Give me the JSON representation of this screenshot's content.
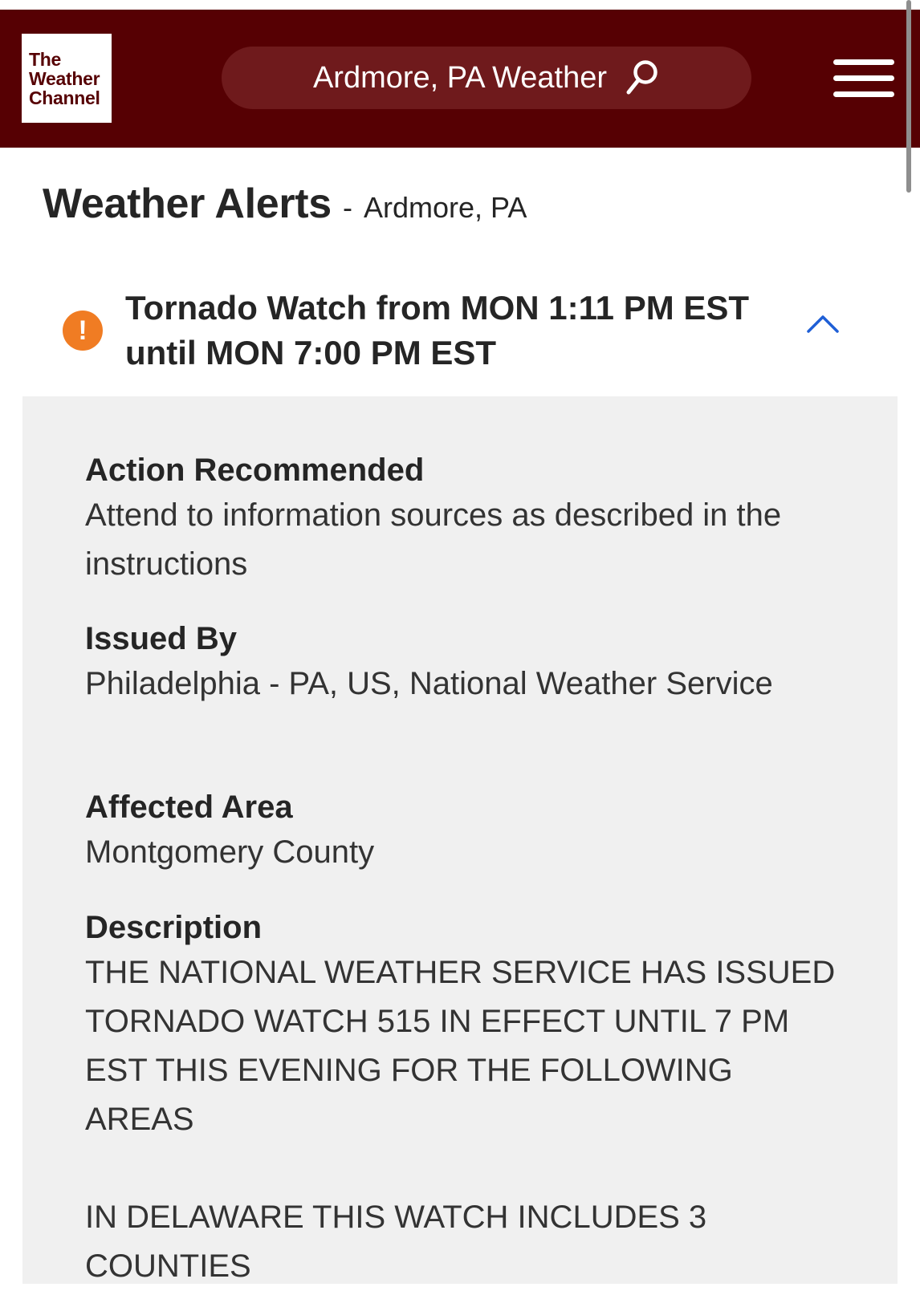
{
  "header": {
    "logo_lines": [
      "The",
      "Weather",
      "Channel"
    ],
    "search_label": "Ardmore, PA Weather",
    "colors": {
      "brand": "#560003",
      "search_bg": "#6f1a1c"
    }
  },
  "page": {
    "title": "Weather Alerts",
    "separator": "-",
    "location": "Ardmore, PA"
  },
  "alert": {
    "title": "Tornado Watch from MON 1:11 PM EST until MON 7:00 PM EST",
    "icon_glyph": "!",
    "icon_color": "#f07c23",
    "expanded": true,
    "sections": {
      "action": {
        "heading": "Action Recommended",
        "text": "Attend to information sources as described in the instructions"
      },
      "issued": {
        "heading": "Issued By",
        "text": "Philadelphia - PA, US, National Weather Service"
      },
      "area": {
        "heading": "Affected Area",
        "text": "Montgomery County"
      },
      "description": {
        "heading": "Description",
        "text": "THE NATIONAL WEATHER SERVICE HAS ISSUED TORNADO WATCH 515 IN EFFECT UNTIL 7 PM EST THIS EVENING FOR THE FOLLOWING AREAS\n\nIN DELAWARE THIS WATCH INCLUDES 3 COUNTIES"
      }
    }
  }
}
